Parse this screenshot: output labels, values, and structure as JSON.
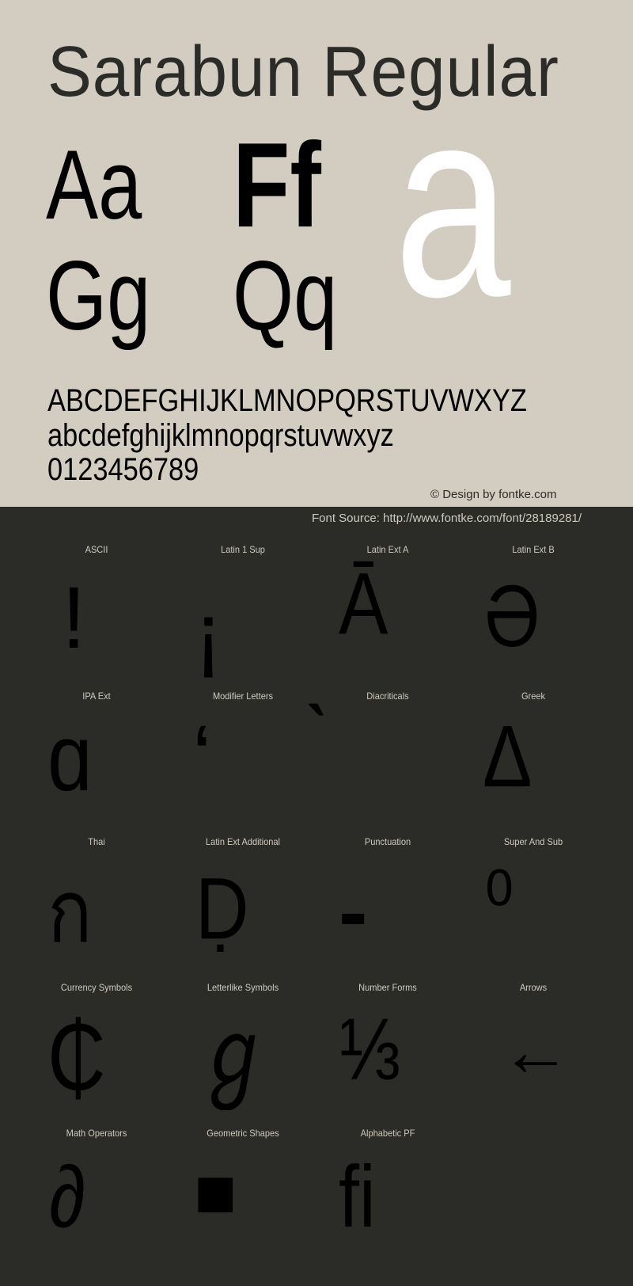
{
  "header": {
    "title": "Sarabun Regular"
  },
  "specimen": {
    "pairs": [
      "Aa",
      "Ff",
      "Gg",
      "Qq"
    ],
    "large_glyph": "a",
    "uppercase": "ABCDEFGHIJKLMNOPQRSTUVWXYZ",
    "lowercase": "abcdefghijklmnopqrstuvwxyz",
    "digits": "0123456789",
    "credit": "© Design by fontke.com"
  },
  "source": {
    "text": "Font Source: http://www.fontke.com/font/28189281/"
  },
  "blocks": [
    {
      "label": "ASCII",
      "glyph": "!"
    },
    {
      "label": "Latin 1 Sup",
      "glyph": "¡"
    },
    {
      "label": "Latin Ext A",
      "glyph": "Ā"
    },
    {
      "label": "Latin Ext B",
      "glyph": "Ə"
    },
    {
      "label": "IPA Ext",
      "glyph": "ɑ"
    },
    {
      "label": "Modifier Letters",
      "glyph": "ʻ"
    },
    {
      "label": "Diacriticals",
      "glyph": "̀"
    },
    {
      "label": "Greek",
      "glyph": "Δ"
    },
    {
      "label": "Thai",
      "glyph": "ก"
    },
    {
      "label": "Latin Ext Additional",
      "glyph": "Ḍ"
    },
    {
      "label": "Punctuation",
      "glyph": "‐"
    },
    {
      "label": "Super And Sub",
      "glyph": "⁰"
    },
    {
      "label": "Currency Symbols",
      "glyph": "₵"
    },
    {
      "label": "Letterlike Symbols",
      "glyph": "ℊ"
    },
    {
      "label": "Number Forms",
      "glyph": "⅓"
    },
    {
      "label": "Arrows",
      "glyph": "←"
    },
    {
      "label": "Math Operators",
      "glyph": "∂"
    },
    {
      "label": "Geometric Shapes",
      "glyph": "■"
    },
    {
      "label": "Alphabetic PF",
      "glyph": "ﬁ"
    }
  ],
  "colors": {
    "top_background": "#d2ccc1",
    "bottom_background": "#2b2b27",
    "title_text": "#2b2b27",
    "glyph_black": "#000000",
    "large_glyph": "#ffffff",
    "label_text": "#cfcac0"
  }
}
